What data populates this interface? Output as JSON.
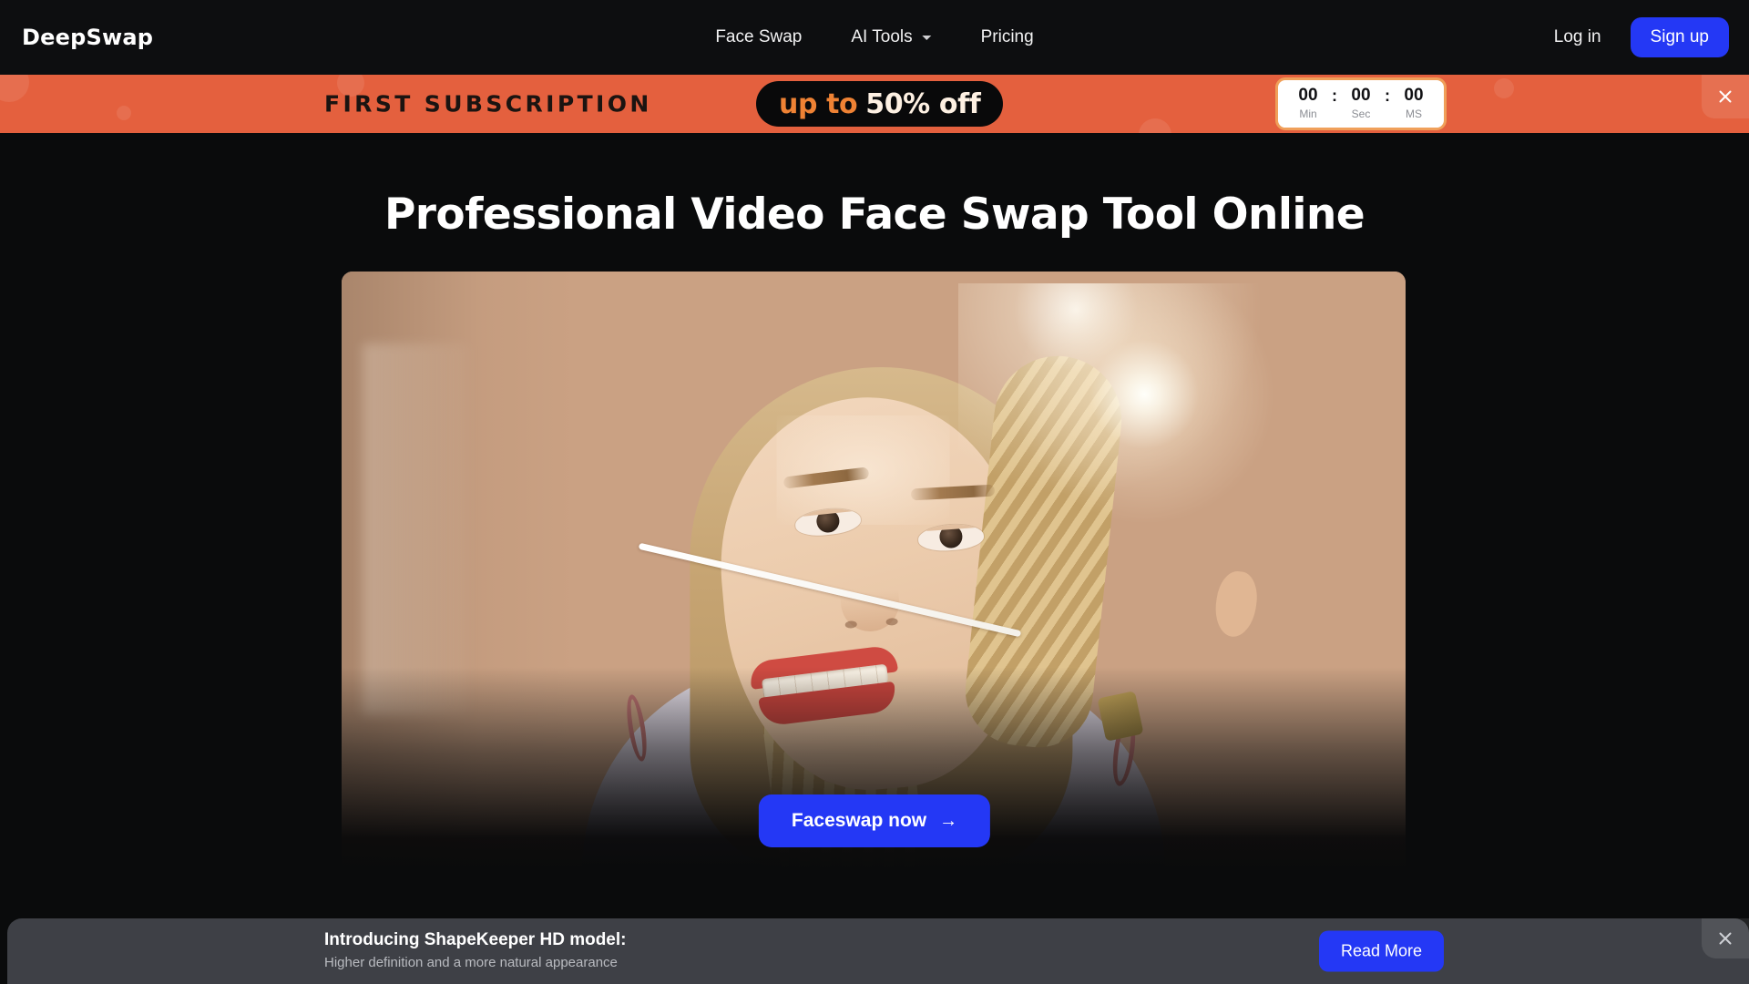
{
  "header": {
    "logo": "DeepSwap",
    "nav": [
      {
        "label": "Face Swap",
        "has_dropdown": false
      },
      {
        "label": "AI Tools",
        "has_dropdown": true
      },
      {
        "label": "Pricing",
        "has_dropdown": false
      }
    ],
    "login_label": "Log in",
    "signup_label": "Sign up",
    "signup_color": "#2438f5"
  },
  "promo_banner": {
    "title": "FIRST SUBSCRIPTION",
    "offer_prefix": "up to",
    "offer_amount": "50% off",
    "background_color": "#e4603e",
    "pill_background": "#09090a",
    "offer_prefix_color": "#ef8234",
    "offer_amount_color": "#fdf0e2",
    "timer": {
      "minutes": "00",
      "seconds": "00",
      "milliseconds": "00",
      "separator": ":",
      "labels": {
        "minutes": "Min",
        "seconds": "Sec",
        "milliseconds": "MS"
      },
      "border_color": "#f0a05a"
    },
    "close_icon": "close-icon"
  },
  "hero": {
    "title": "Professional Video Face Swap Tool Online",
    "cta_label": "Faceswap now",
    "cta_arrow": "→",
    "cta_color": "#2438f5",
    "media_alt": "Smiling blonde woman with red lipstick and hoop earrings in warm beige room"
  },
  "bottom_notice": {
    "title": "Introducing ShapeKeeper HD model:",
    "subtitle": "Higher definition and a more natural appearance",
    "button_label": "Read More",
    "background_color": "#3e4046",
    "button_color": "#2438f5",
    "close_icon": "close-icon"
  }
}
